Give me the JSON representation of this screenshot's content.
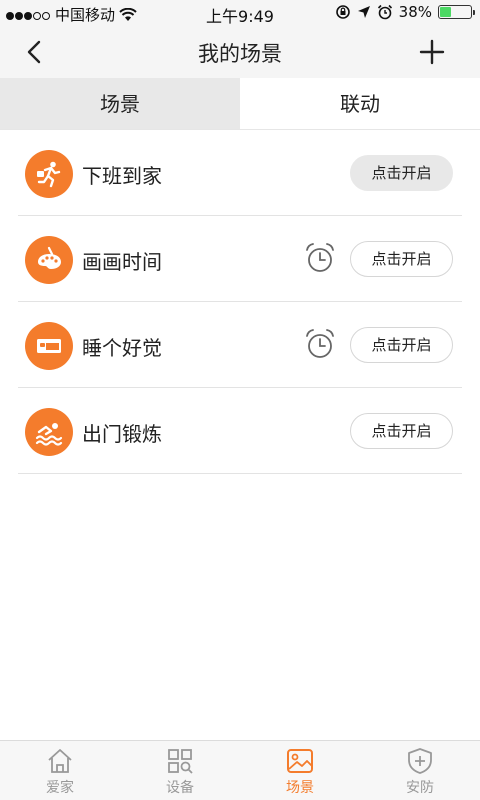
{
  "status_bar": {
    "carrier": "中国移动",
    "time": "上午9:49",
    "battery": "38%",
    "battery_level": 0.38
  },
  "nav": {
    "title": "我的场景"
  },
  "tabs": [
    {
      "label": "场景",
      "active": true
    },
    {
      "label": "联动",
      "active": false
    }
  ],
  "scenes": [
    {
      "name": "下班到家",
      "icon": "running-home-icon",
      "has_alarm": false,
      "button": "点击开启",
      "pressed": true
    },
    {
      "name": "画画时间",
      "icon": "palette-icon",
      "has_alarm": true,
      "button": "点击开启",
      "pressed": false
    },
    {
      "name": "睡个好觉",
      "icon": "bed-icon",
      "has_alarm": true,
      "button": "点击开启",
      "pressed": false
    },
    {
      "name": "出门锻炼",
      "icon": "swimming-icon",
      "has_alarm": false,
      "button": "点击开启",
      "pressed": false
    }
  ],
  "tabbar": [
    {
      "label": "爱家",
      "icon": "home-icon",
      "active": false
    },
    {
      "label": "设备",
      "icon": "devices-icon",
      "active": false
    },
    {
      "label": "场景",
      "icon": "scene-icon",
      "active": true
    },
    {
      "label": "安防",
      "icon": "shield-icon",
      "active": false
    }
  ],
  "colors": {
    "accent": "#f47c2c",
    "inactive": "#999999"
  }
}
